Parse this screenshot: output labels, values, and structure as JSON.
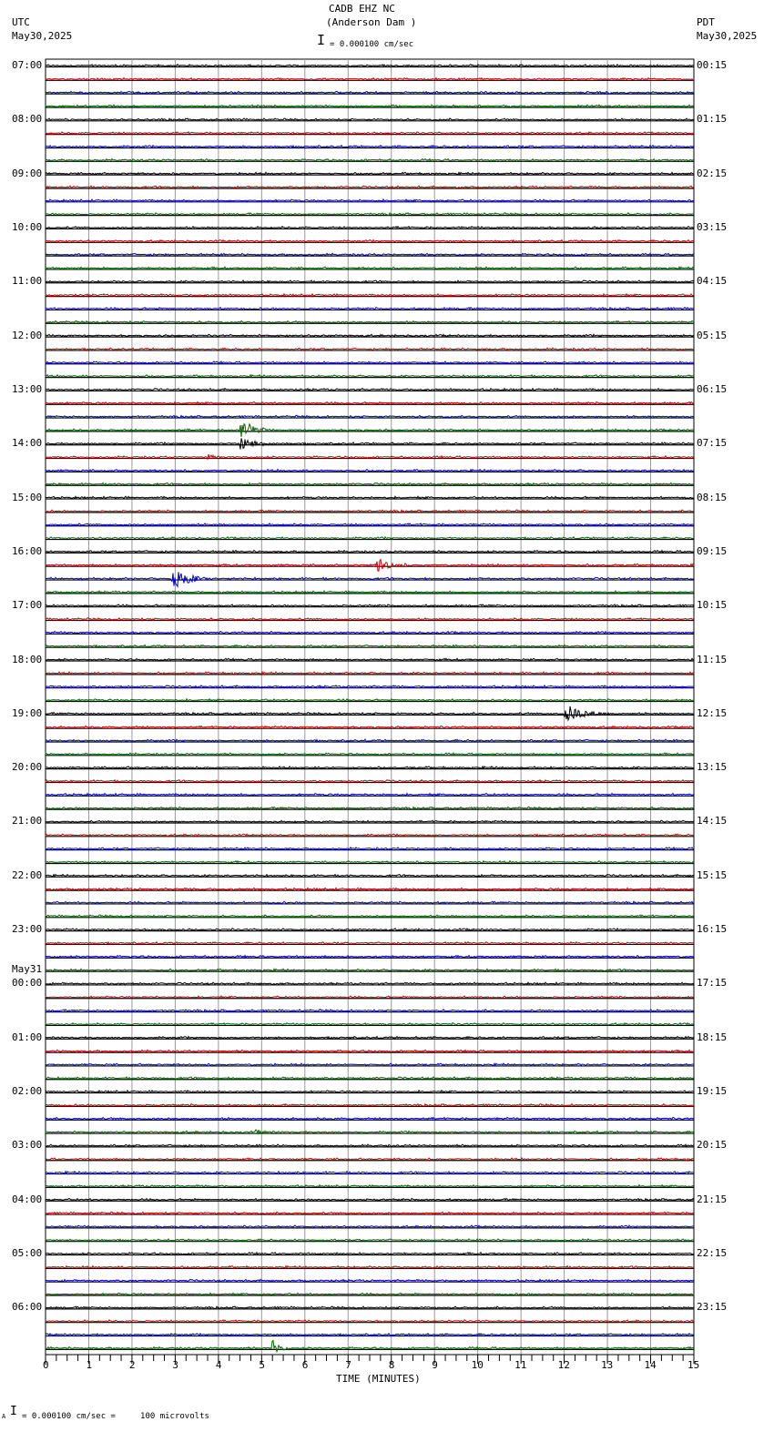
{
  "header": {
    "title": "CADB EHZ NC",
    "subtitle": "(Anderson Dam )",
    "scale": "= 0.000100 cm/sec",
    "left_tz": "UTC",
    "left_date": "May30,2025",
    "right_tz": "PDT",
    "right_date": "May30,2025"
  },
  "footer": {
    "mark": "A",
    "text": "= 0.000100 cm/sec =     100 microvolts"
  },
  "chart_data": {
    "type": "line",
    "title": "CADB EHZ NC (Anderson Dam )",
    "xlabel": "TIME (MINUTES)",
    "xlim": [
      0,
      15
    ],
    "xticks": [
      "0",
      "1",
      "2",
      "3",
      "4",
      "5",
      "6",
      "7",
      "8",
      "9",
      "10",
      "11",
      "12",
      "13",
      "14",
      "15"
    ],
    "row_minutes": 15,
    "row_count": 96,
    "trace_colors": [
      "#000000",
      "#cc0000",
      "#0000cc",
      "#006600"
    ],
    "left_labels": [
      "07:00",
      "08:00",
      "09:00",
      "10:00",
      "11:00",
      "12:00",
      "13:00",
      "14:00",
      "15:00",
      "16:00",
      "17:00",
      "18:00",
      "19:00",
      "20:00",
      "21:00",
      "22:00",
      "23:00",
      "00:00",
      "01:00",
      "02:00",
      "03:00",
      "04:00",
      "05:00",
      "06:00"
    ],
    "date_change_label": "May31",
    "right_labels": [
      "00:15",
      "01:15",
      "02:15",
      "03:15",
      "04:15",
      "05:15",
      "06:15",
      "07:15",
      "08:15",
      "09:15",
      "10:15",
      "11:15",
      "12:15",
      "13:15",
      "14:15",
      "15:15",
      "16:15",
      "17:15",
      "18:15",
      "19:15",
      "20:15",
      "21:15",
      "22:15",
      "23:15"
    ],
    "events": [
      {
        "row": 27,
        "minute": 4.55,
        "amplitude": 14,
        "duration": 0.6
      },
      {
        "row": 28,
        "minute": 4.55,
        "amplitude": 6,
        "duration": 0.8
      },
      {
        "row": 29,
        "minute": 3.8,
        "amplitude": 3,
        "duration": 0.2
      },
      {
        "row": 37,
        "minute": 7.7,
        "amplitude": 8,
        "duration": 0.7
      },
      {
        "row": 38,
        "minute": 2.95,
        "amplitude": 12,
        "duration": 0.9
      },
      {
        "row": 48,
        "minute": 12.05,
        "amplitude": 10,
        "duration": 1.0
      },
      {
        "row": 79,
        "minute": 4.9,
        "amplitude": 2,
        "duration": 0.4
      },
      {
        "row": 95,
        "minute": 5.28,
        "amplitude": 8,
        "duration": 0.4
      }
    ]
  }
}
